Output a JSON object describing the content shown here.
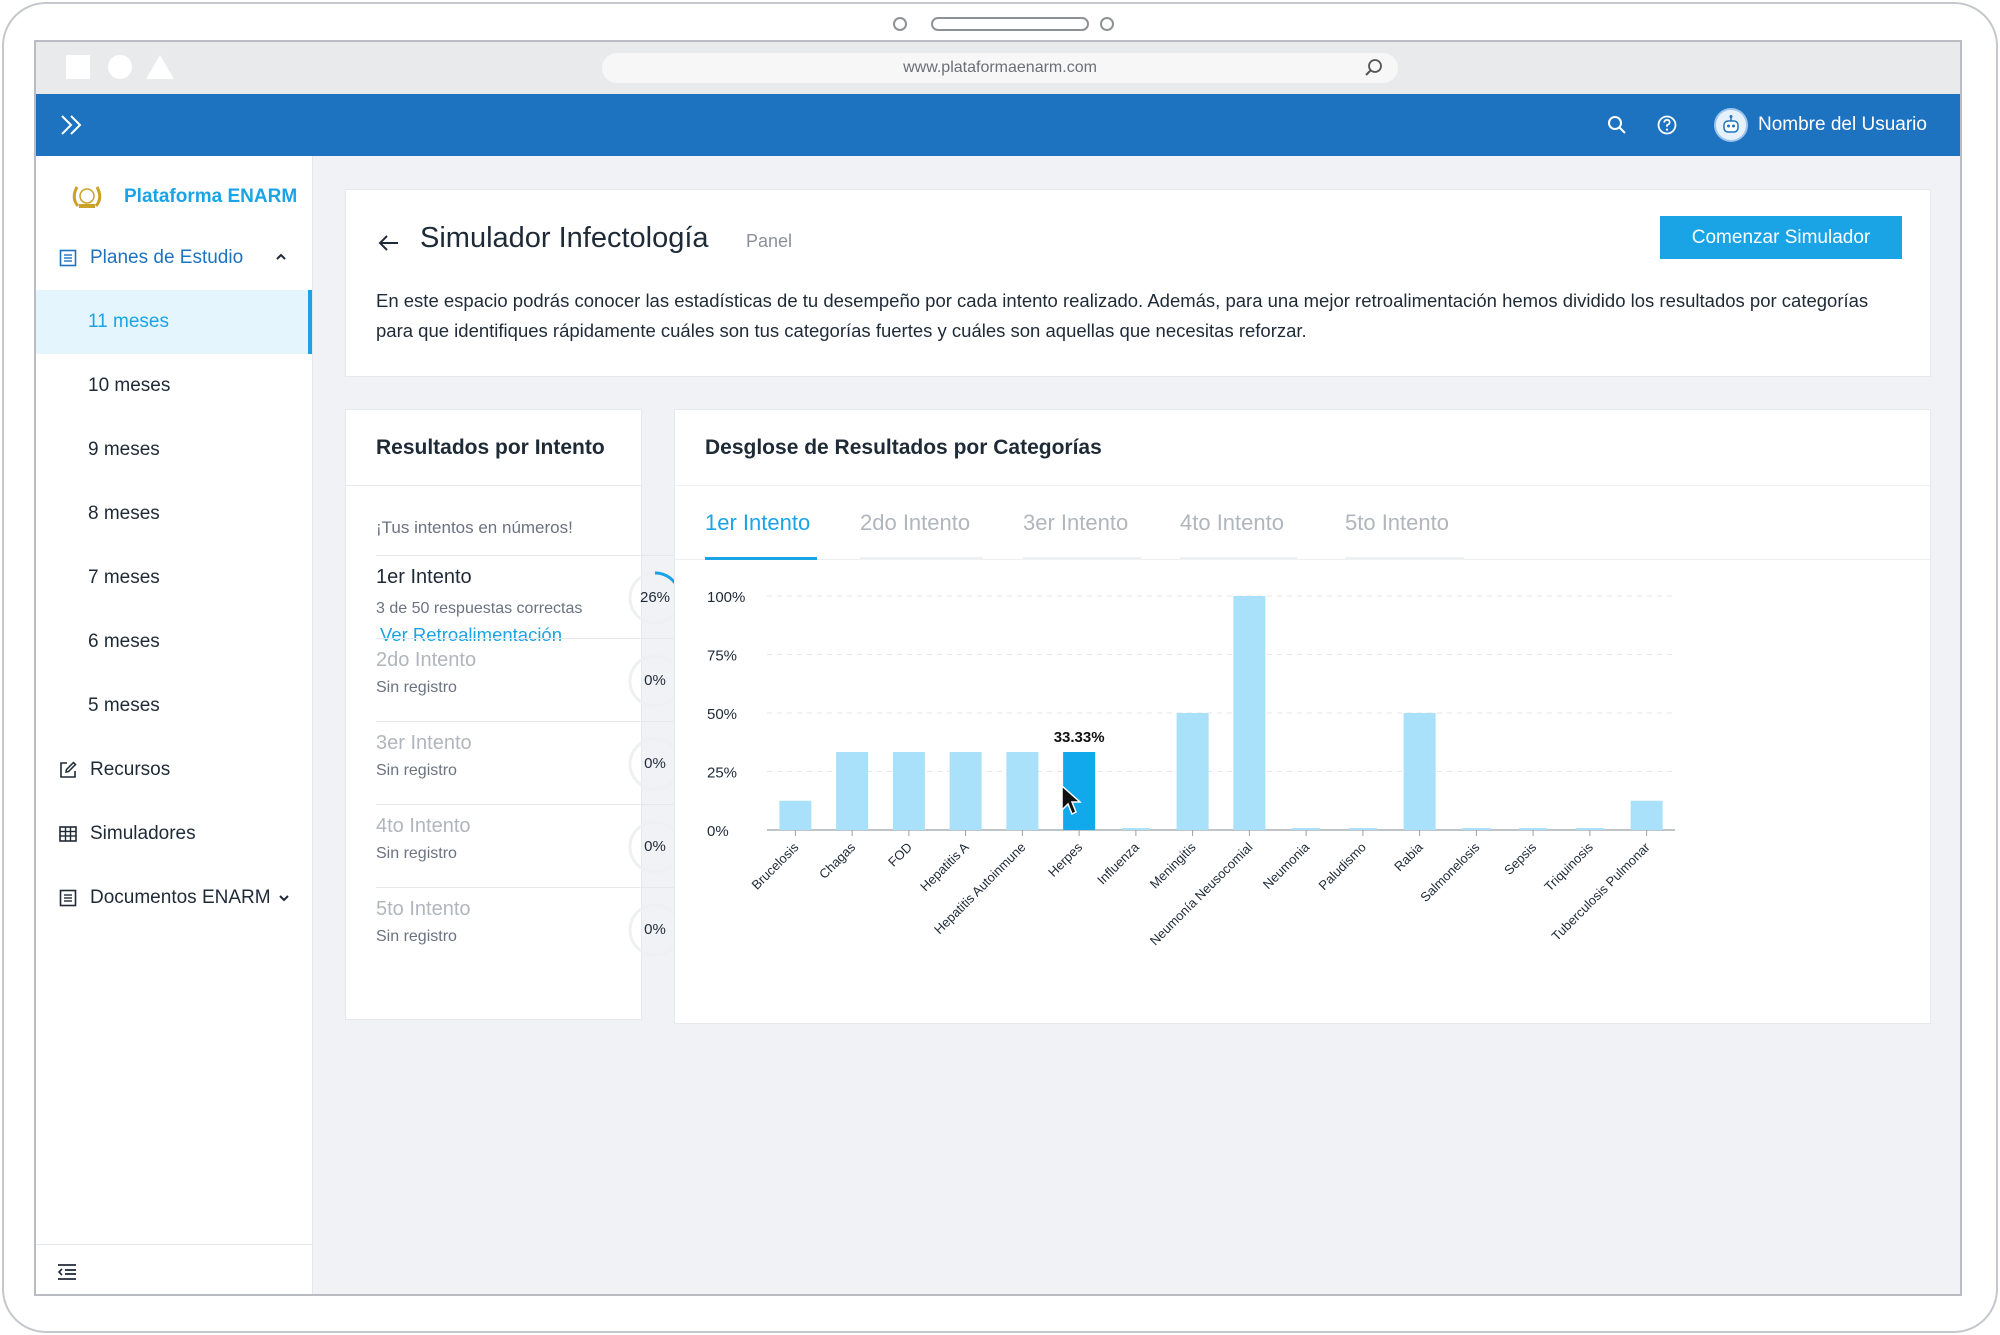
{
  "browser": {
    "url": "www.plataformaenarm.com"
  },
  "header": {
    "user_name": "Nombre del Usuario"
  },
  "sidebar": {
    "brand": "Plataforma ENARM",
    "plans_label": "Planes de Estudio",
    "plans": [
      "11 meses",
      "10 meses",
      "9 meses",
      "8 meses",
      "7 meses",
      "6 meses",
      "5 meses"
    ],
    "active_plan": "11 meses",
    "resources_label": "Recursos",
    "simulators_label": "Simuladores",
    "documents_label": "Documentos ENARM"
  },
  "page": {
    "title": "Simulador Infectología",
    "subtitle": "Panel",
    "start_button": "Comenzar Simulador",
    "description": "En este espacio podrás conocer las estadísticas de tu desempeño por cada intento realizado. Además, para una mejor retroalimentación hemos dividido los resultados por categorías para que identifiques rápidamente cuáles son tus categorías fuertes y cuáles son aquellas que necesitas reforzar."
  },
  "results": {
    "title": "Resultados por Intento",
    "intro": "¡Tus intentos en números!",
    "attempts": [
      {
        "name": "1er Intento",
        "detail": "3 de 50 respuestas correctas",
        "link": "Ver Retroalimentación",
        "percent_label": "26%",
        "progress": 0.26
      },
      {
        "name": "2do Intento",
        "detail": "Sin registro",
        "percent_label": "0%",
        "progress": 0
      },
      {
        "name": "3er Intento",
        "detail": "Sin registro",
        "percent_label": "0%",
        "progress": 0
      },
      {
        "name": "4to Intento",
        "detail": "Sin registro",
        "percent_label": "0%",
        "progress": 0
      },
      {
        "name": "5to Intento",
        "detail": "Sin registro",
        "percent_label": "0%",
        "progress": 0
      }
    ]
  },
  "breakdown": {
    "title": "Desglose de Resultados por Categorías",
    "tabs": [
      "1er Intento",
      "2do Intento",
      "3er Intento",
      "4to Intento",
      "5to Intento"
    ],
    "active_tab": "1er Intento"
  },
  "chart_data": {
    "type": "bar",
    "categories": [
      "Brucelosis",
      "Chagas",
      "FOD",
      "Hepatitis A",
      "Hepatitis Autoinmune",
      "Herpes",
      "Influenza",
      "Meningitis",
      "Neumonía Neusocomial",
      "Neumonia",
      "Paludismo",
      "Rabia",
      "Salmonelosis",
      "Sepsis",
      "Triquinosis",
      "Tuberculosis Pulmonar"
    ],
    "values": [
      12.5,
      33.33,
      33.33,
      33.33,
      33.33,
      33.33,
      0,
      50,
      100,
      0,
      0,
      50,
      0,
      0,
      0,
      12.5
    ],
    "ylim": [
      0,
      100
    ],
    "yticks": [
      "0%",
      "25%",
      "50%",
      "75%",
      "100%"
    ],
    "tooltip": {
      "category": "Herpes",
      "label": "33.33%"
    },
    "bar_color": "#a8e1f9",
    "highlight_color": "#11a8ec",
    "grid": true
  }
}
